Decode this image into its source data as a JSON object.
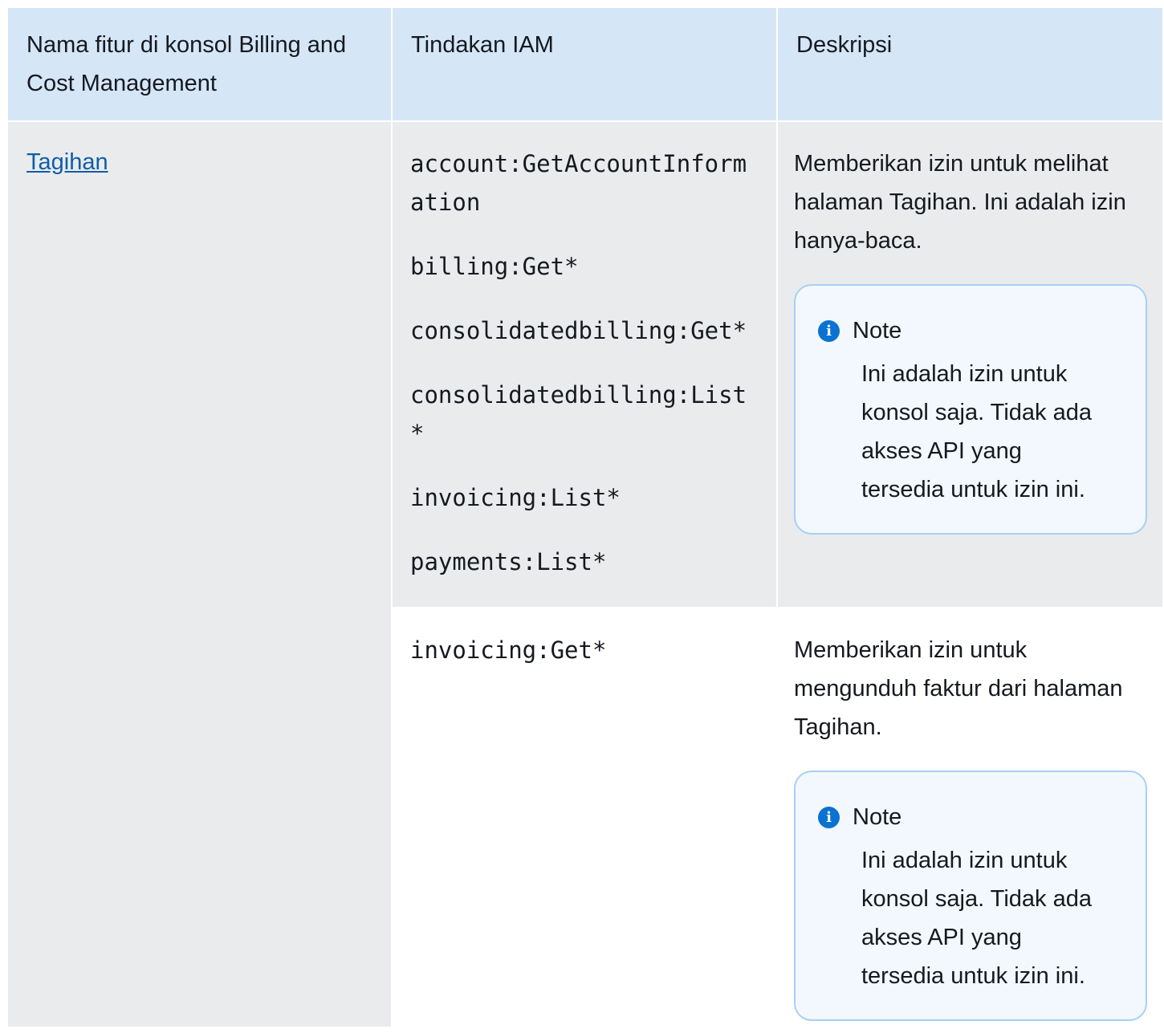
{
  "table": {
    "headers": [
      "Nama fitur di konsol Billing and Cost Management",
      "Tindakan IAM",
      "Deskripsi"
    ],
    "feature_link": "Tagihan",
    "rows": [
      {
        "actions": [
          "account:GetAccountInformation",
          "billing:Get*",
          "consolidatedbilling:Get*",
          "consolidatedbilling:List*",
          "invoicing:List*",
          "payments:List*"
        ],
        "description": "Memberikan izin untuk melihat halaman Tagihan. Ini adalah izin hanya-baca.",
        "note": {
          "title": "Note",
          "body": "Ini adalah izin untuk konsol saja. Tidak ada akses API yang tersedia untuk izin ini."
        }
      },
      {
        "actions": [
          "invoicing:Get*"
        ],
        "description": "Memberikan izin untuk mengunduh faktur dari halaman Tagihan.",
        "note": {
          "title": "Note",
          "body": "Ini adalah izin untuk konsol saja. Tidak ada akses API yang tersedia untuk izin ini."
        }
      }
    ]
  },
  "colors": {
    "header_bg": "#d5e6f7",
    "row_bg": "#e9ebed",
    "link": "#0f5ea8",
    "note_border": "#a8d0f2",
    "note_bg": "#f2f8fd",
    "info_icon": "#0972d3"
  },
  "icons": {
    "note_icon": "info-icon"
  }
}
